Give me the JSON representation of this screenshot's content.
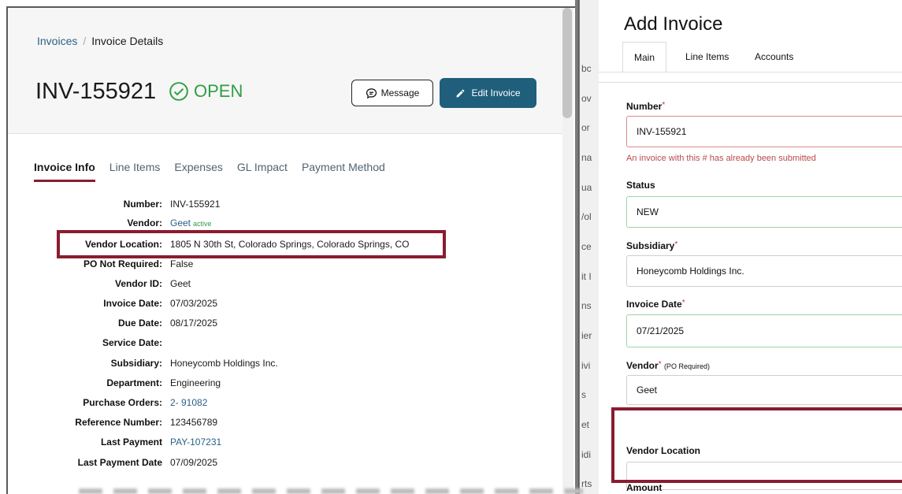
{
  "left": {
    "breadcrumb": {
      "link": "Invoices",
      "separator": "/",
      "current": "Invoice Details"
    },
    "invoice_number": "INV-155921",
    "status": "OPEN",
    "buttons": {
      "message": "Message",
      "edit": "Edit Invoice"
    },
    "tabs": [
      "Invoice Info",
      "Line Items",
      "Expenses",
      "GL Impact",
      "Payment Method"
    ],
    "active_tab": "Invoice Info",
    "info": [
      {
        "label": "Number:",
        "value": "INV-155921"
      },
      {
        "label": "Vendor:",
        "value": "Geet",
        "badge": "active",
        "link": true
      },
      {
        "label": "Vendor Location:",
        "value": "1805 N 30th St, Colorado Springs, Colorado Springs, CO"
      },
      {
        "label": "PO Not Required:",
        "value": "False"
      },
      {
        "label": "Vendor ID:",
        "value": "Geet"
      },
      {
        "label": "Invoice Date:",
        "value": "07/03/2025"
      },
      {
        "label": "Due Date:",
        "value": "08/17/2025"
      },
      {
        "label": "Service Date:",
        "value": ""
      },
      {
        "label": "Subsidiary:",
        "value": "Honeycomb Holdings Inc."
      },
      {
        "label": "Department:",
        "value": "Engineering"
      },
      {
        "label": "Purchase Orders:",
        "value": "2- 91082",
        "link": true
      },
      {
        "label": "Reference Number:",
        "value": "123456789"
      },
      {
        "label": "Last Payment",
        "value": "PAY-107231",
        "link": true
      },
      {
        "label": "Last Payment Date",
        "value": "07/09/2025"
      }
    ]
  },
  "middle": {
    "fragments": [
      "bc",
      "ov",
      "or",
      "na",
      "ua",
      "/ol",
      "ce",
      "it I",
      "ns",
      "ier",
      "ivi",
      "s",
      "et",
      "idi",
      "rts"
    ]
  },
  "form": {
    "title": "Add Invoice",
    "tabs": [
      "Main",
      "Line Items",
      "Accounts"
    ],
    "active_tab": "Main",
    "number_label": "Number",
    "number_value": "INV-155921",
    "number_error": "An invoice with this # has already been submitted",
    "status_label": "Status",
    "status_value": "NEW",
    "subsidiary_label": "Subsidiary",
    "subsidiary_value": "Honeycomb Holdings Inc.",
    "invoice_date_label": "Invoice Date",
    "invoice_date_value": "07/21/2025",
    "vendor_label": "Vendor",
    "vendor_note": "(PO Required)",
    "vendor_value": "Geet",
    "vendor_location_label": "Vendor Location",
    "vendor_location_value": "",
    "amount_label": "Amount",
    "required_mark": "*"
  },
  "colors": {
    "accent": "#1f5f7c",
    "highlight": "#8a1c30",
    "status_green": "#2f9e44",
    "link": "#2a6186",
    "error": "#b84b4b"
  },
  "icons": {
    "status": "check-circle-icon",
    "message": "chat-bubble-icon",
    "edit": "pencil-icon"
  }
}
